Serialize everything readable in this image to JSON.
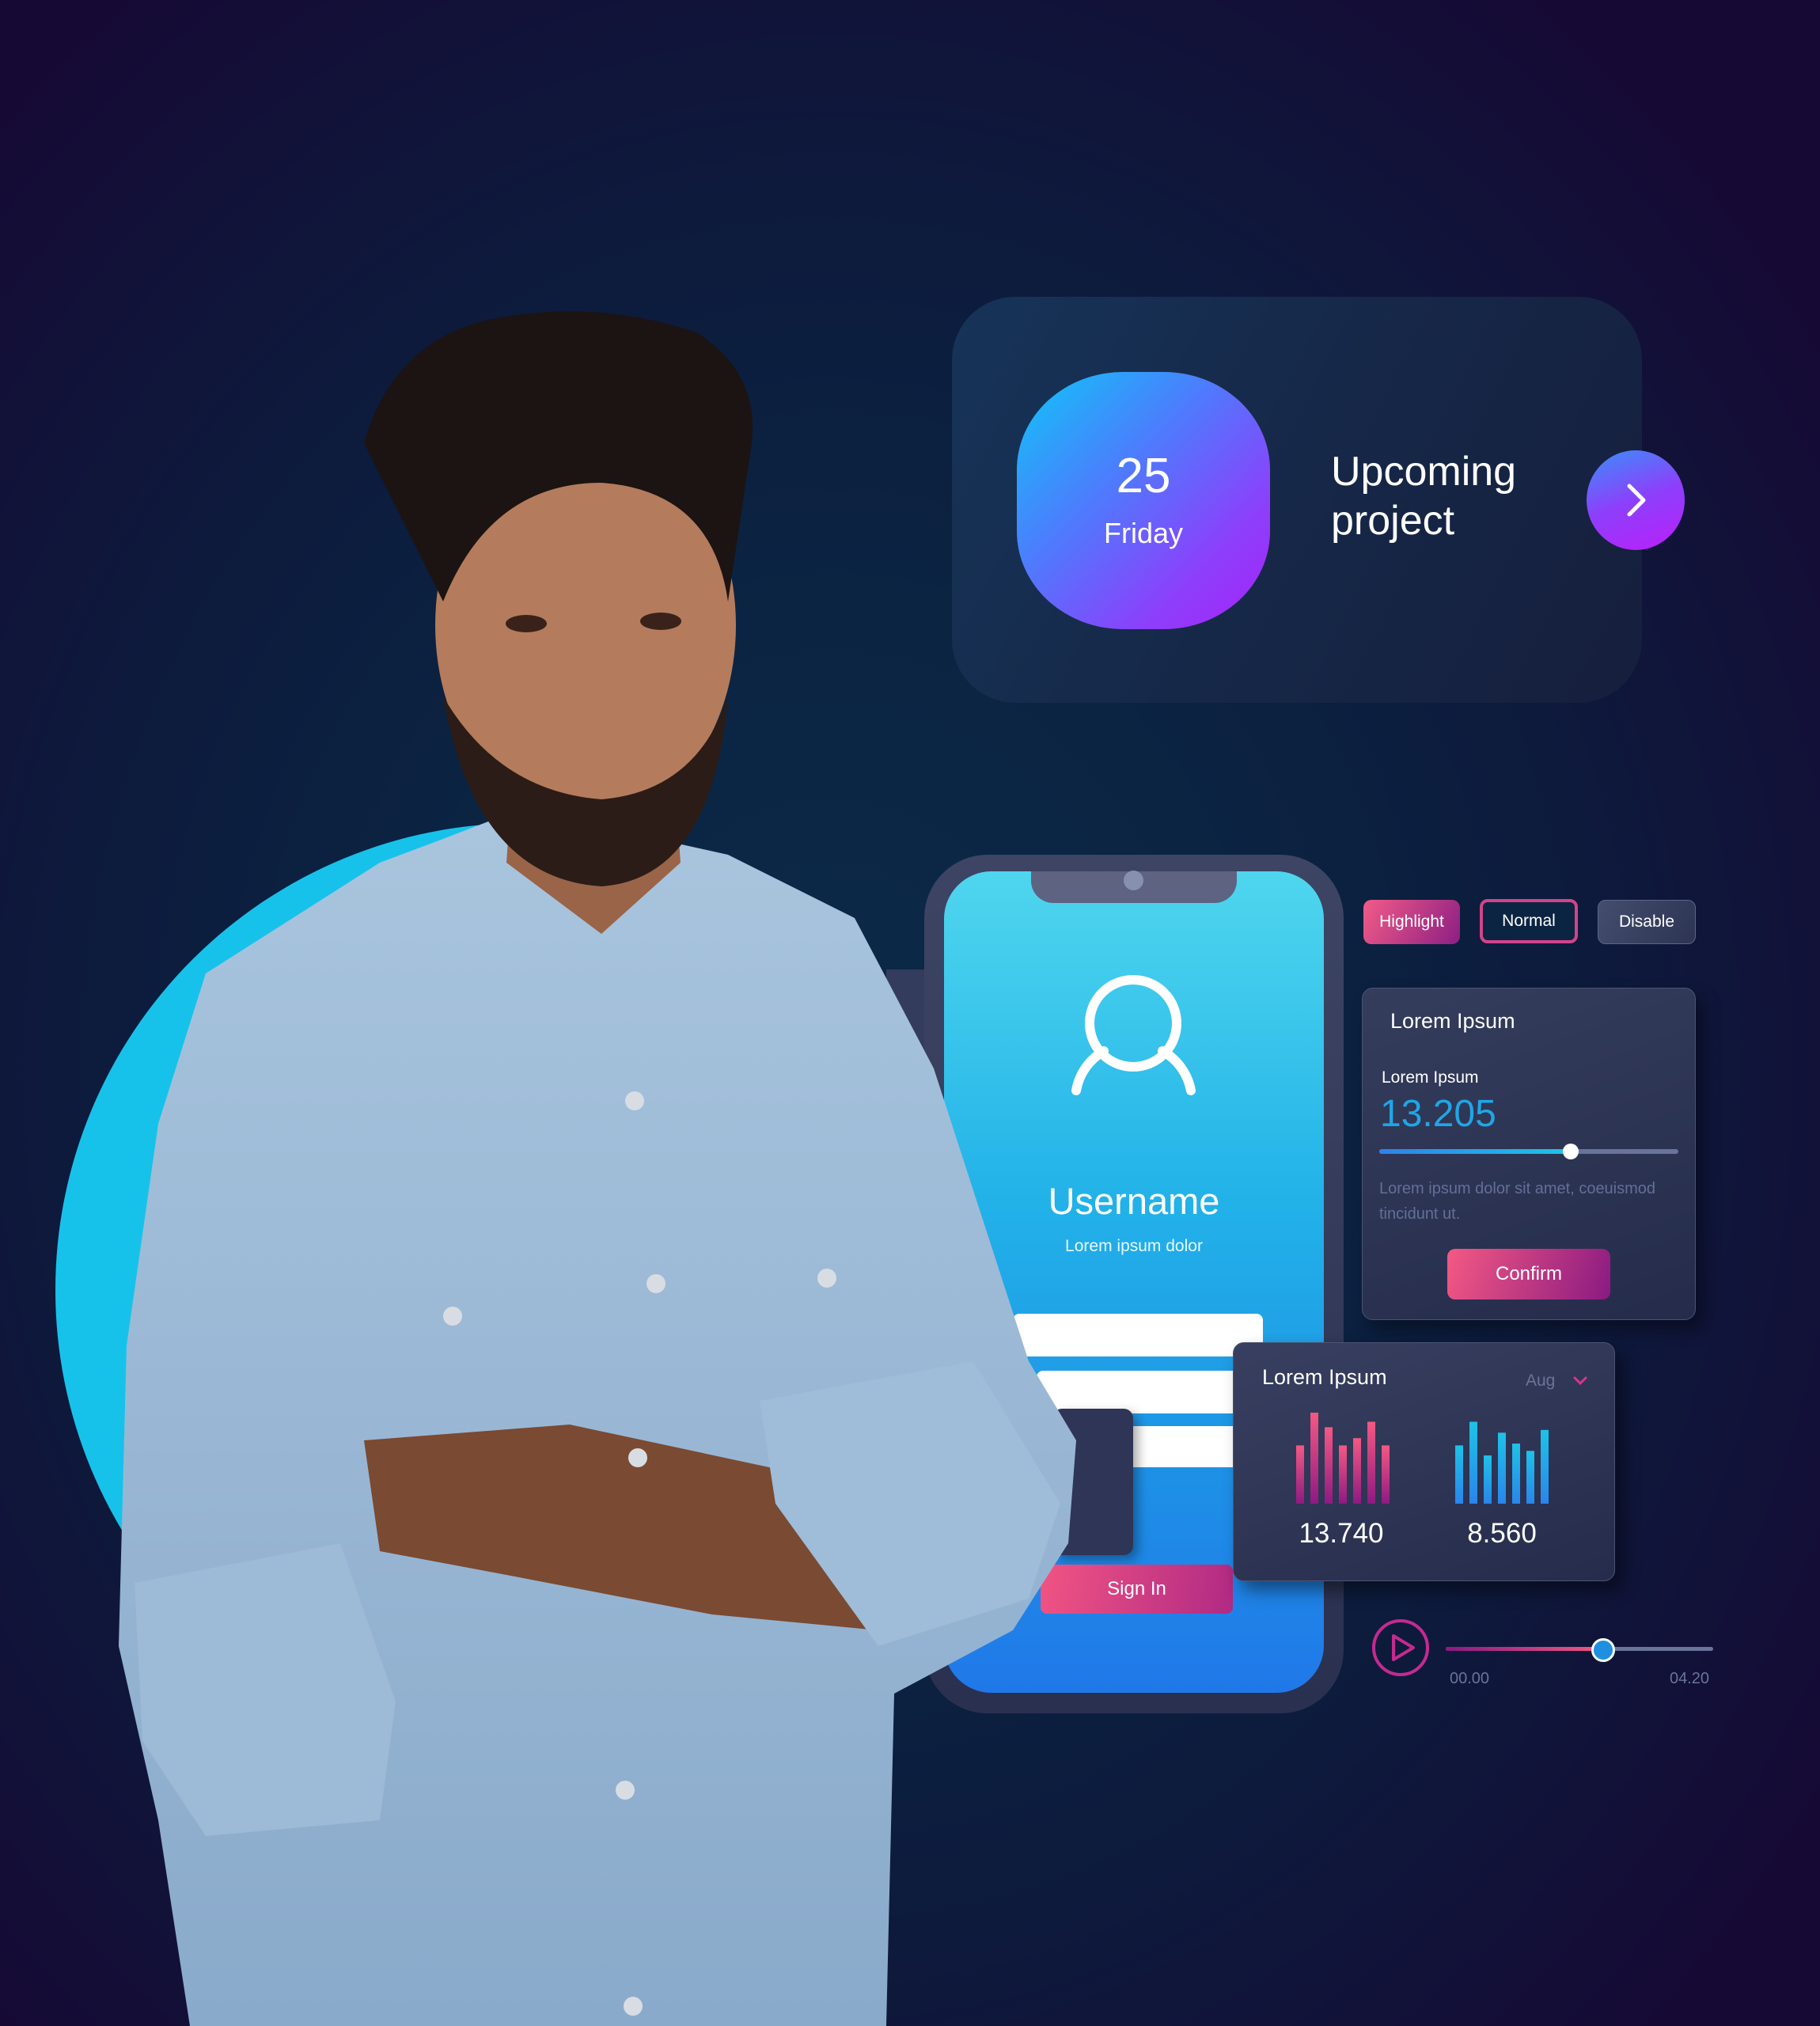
{
  "upcoming_card": {
    "date_number": "25",
    "date_day": "Friday",
    "title_line1": "Upcoming",
    "title_line2": "project",
    "next_icon": "chevron-right-icon"
  },
  "phone": {
    "user_icon": "user-icon",
    "username_label": "Username",
    "subtitle": "Lorem ipsum dolor",
    "username_field_value": "",
    "password_field_value": "",
    "sign_in_label": "Sign In"
  },
  "button_states": {
    "highlight_label": "Highlight",
    "normal_label": "Normal",
    "disable_label": "Disable"
  },
  "stat_card": {
    "title": "Lorem Ipsum",
    "subtitle": "Lorem Ipsum",
    "value": "13.205",
    "slider_fraction": 0.64,
    "description": "Lorem ipsum dolor sit amet, coeuismod tincidunt ut.",
    "confirm_label": "Confirm"
  },
  "chart_card": {
    "title": "Lorem Ipsum",
    "month_selected": "Aug",
    "left_total": "13.740",
    "right_total": "8.560"
  },
  "chart_data": {
    "type": "bar",
    "title": "Lorem Ipsum",
    "xlabel": "",
    "ylabel": "",
    "series": [
      {
        "name": "13.740",
        "color": "#f05a88",
        "values": [
          64,
          100,
          84,
          64,
          72,
          90,
          64
        ]
      },
      {
        "name": "8.560",
        "color": "#1fa6e8",
        "values": [
          64,
          90,
          53,
          78,
          66,
          58,
          81
        ]
      }
    ],
    "ylim": [
      0,
      100
    ]
  },
  "audio_player": {
    "play_icon": "play-icon",
    "current_time": "00.00",
    "total_time": "04.20",
    "progress_fraction": 0.59
  },
  "colors": {
    "accent_pink": "#f05a88",
    "accent_purple": "#a622f8",
    "accent_cyan": "#17c2ea",
    "accent_blue": "#1fa6e6"
  }
}
